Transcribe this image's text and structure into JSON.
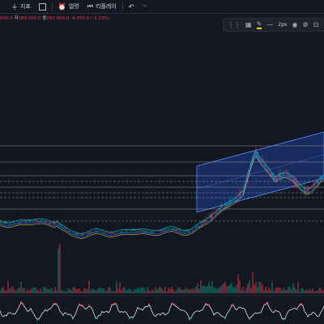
{
  "toolbar": {
    "indicator_icon": "indicator-icon",
    "indicator_label": "지표",
    "layout_icon": "grid-icon",
    "alert_icon": "alarm-clock-icon",
    "alert_label": "얼럿",
    "replay_icon": "replay-icon",
    "replay_label": "리플레이",
    "undo_icon": "undo-icon",
    "redo_icon": "redo-icon"
  },
  "ohlc": {
    "open_value": "650.0",
    "high_label": "저",
    "high_value": "289,000.0",
    "close_label": "종",
    "close_value": "292,900.0",
    "change_value": "-9,450.0 (-3.13%)"
  },
  "drawing_toolbar": {
    "width_label": "2px",
    "icons": [
      "drag-handle-icon",
      "template-icon",
      "pen-icon",
      "line-style-icon",
      "eye-icon",
      "settings-icon",
      "lock-icon"
    ]
  },
  "colors": {
    "background": "#131722",
    "channel_fill": "#2962ff",
    "up": "#089981",
    "down": "#f23645",
    "rsi_line": "#ffffff",
    "overlay_cyan": "#00bcd4"
  }
}
